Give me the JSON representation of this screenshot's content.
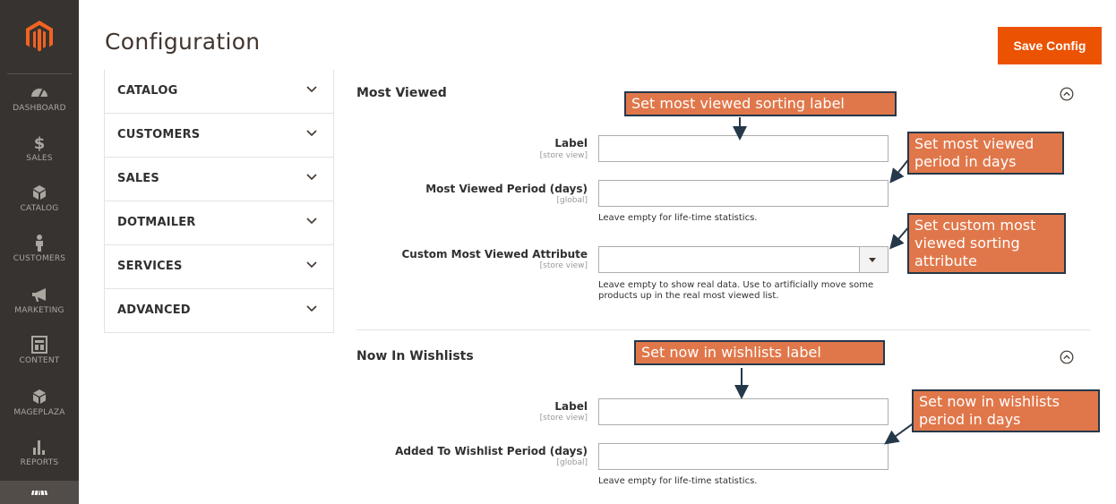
{
  "nav": {
    "items": [
      {
        "key": "dashboard",
        "label": "DASHBOARD"
      },
      {
        "key": "sales",
        "label": "SALES"
      },
      {
        "key": "catalog",
        "label": "CATALOG"
      },
      {
        "key": "customers",
        "label": "CUSTOMERS"
      },
      {
        "key": "marketing",
        "label": "MARKETING"
      },
      {
        "key": "content",
        "label": "CONTENT"
      },
      {
        "key": "mageplaza",
        "label": "MAGEPLAZA"
      },
      {
        "key": "reports",
        "label": "REPORTS"
      }
    ]
  },
  "header": {
    "title": "Configuration",
    "save_label": "Save Config"
  },
  "tabs": [
    {
      "label": "CATALOG"
    },
    {
      "label": "CUSTOMERS"
    },
    {
      "label": "SALES"
    },
    {
      "label": "DOTMAILER"
    },
    {
      "label": "SERVICES"
    },
    {
      "label": "ADVANCED"
    }
  ],
  "most_viewed": {
    "title": "Most Viewed",
    "label_field": {
      "label": "Label",
      "scope": "[store view]",
      "value": ""
    },
    "period_field": {
      "label": "Most Viewed Period (days)",
      "scope": "[global]",
      "value": "",
      "note": "Leave empty for life-time statistics."
    },
    "attribute_field": {
      "label": "Custom Most Viewed Attribute",
      "scope": "[store view]",
      "value": "",
      "note": "Leave empty to show real data. Use to artificially move some products up in the real most viewed list."
    }
  },
  "now_in_wishlists": {
    "title": "Now In Wishlists",
    "label_field": {
      "label": "Label",
      "scope": "[store view]",
      "value": ""
    },
    "period_field": {
      "label": "Added To Wishlist Period (days)",
      "scope": "[global]",
      "value": "",
      "note": "Leave empty for life-time statistics."
    }
  },
  "callouts": {
    "mv_label": "Set most viewed sorting label",
    "mv_period": "Set most viewed period in days",
    "mv_attribute": "Set custom most viewed sorting attribute",
    "nw_label": "Set now in wishlists label",
    "nw_period": "Set now in wishlists period in days"
  },
  "colors": {
    "nav_bg": "#373330",
    "accent": "#eb5202",
    "callout_bg": "#e0774a",
    "callout_border": "#25384a"
  }
}
